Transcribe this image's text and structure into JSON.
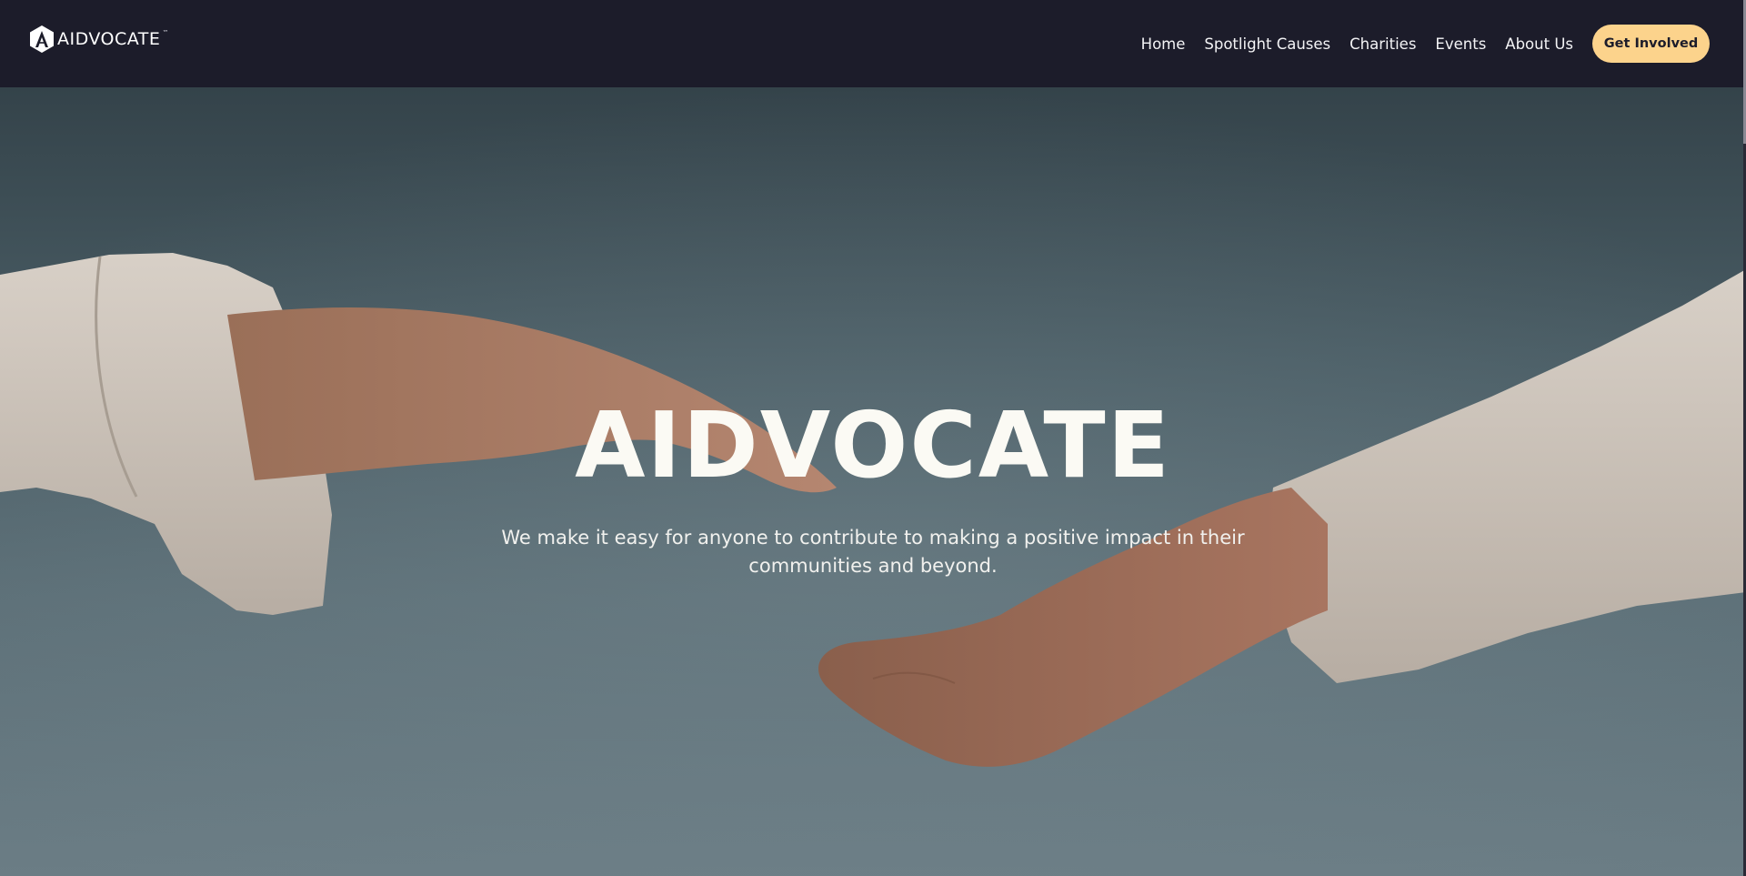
{
  "header": {
    "logo_text": "AIDVOCATE",
    "logo_tm": "™",
    "nav": [
      {
        "label": "Home"
      },
      {
        "label": "Spotlight Causes"
      },
      {
        "label": "Charities"
      },
      {
        "label": "Events"
      },
      {
        "label": "About Us"
      }
    ],
    "cta_label": "Get Involved"
  },
  "hero": {
    "title": "AIDVOCATE",
    "subtitle": "We make it easy for anyone to contribute to making a positive impact in their communities and beyond."
  },
  "colors": {
    "header_bg": "#1c1c2a",
    "cta_bg": "#fcd38c",
    "hero_text": "#fbfaf4"
  },
  "icons": {
    "logo": "aidvocate-logo-icon"
  }
}
